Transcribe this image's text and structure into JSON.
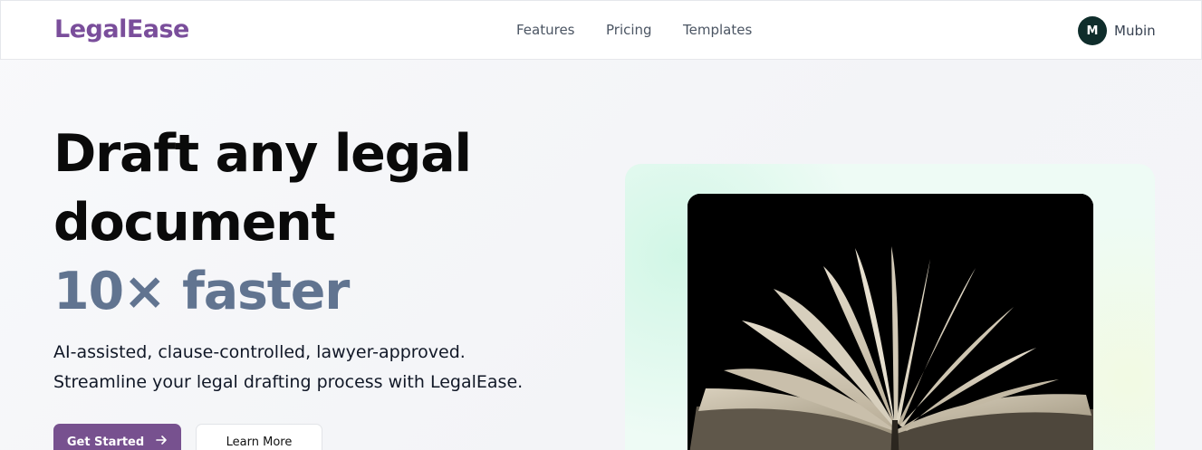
{
  "brand": {
    "name": "LegalEase",
    "color": "#7a4e9b"
  },
  "nav": {
    "links": [
      {
        "label": "Features"
      },
      {
        "label": "Pricing"
      },
      {
        "label": "Templates"
      }
    ]
  },
  "user": {
    "initial": "M",
    "name": "Mubin"
  },
  "hero": {
    "title_line1": "Draft any legal",
    "title_line2": "document",
    "title_accent": "10× faster",
    "subtitle_line1": "AI-assisted, clause-controlled, lawyer-approved.",
    "subtitle_line2": "Streamline your legal drafting process with LegalEase."
  },
  "actions": {
    "primary_label": "Get Started",
    "primary_icon": "arrow-right-icon",
    "secondary_label": "Learn More"
  },
  "colors": {
    "accent_text": "#617490",
    "primary_button": "#77518f",
    "avatar_bg": "#0f2d2b",
    "panel_bg": "#eefbf5"
  }
}
